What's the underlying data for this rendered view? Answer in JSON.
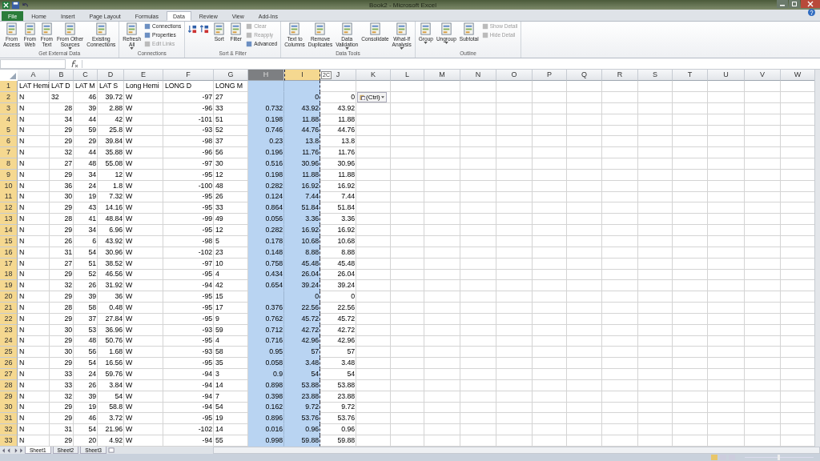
{
  "window": {
    "title": "Book2 - Microsoft Excel"
  },
  "tabs": [
    {
      "label": "File",
      "kind": "file",
      "selected": false
    },
    {
      "label": "Home",
      "kind": "tab",
      "selected": false
    },
    {
      "label": "Insert",
      "kind": "tab",
      "selected": false
    },
    {
      "label": "Page Layout",
      "kind": "tab",
      "selected": false
    },
    {
      "label": "Formulas",
      "kind": "tab",
      "selected": false
    },
    {
      "label": "Data",
      "kind": "tab",
      "selected": true
    },
    {
      "label": "Review",
      "kind": "tab",
      "selected": false
    },
    {
      "label": "View",
      "kind": "tab",
      "selected": false
    },
    {
      "label": "Add-Ins",
      "kind": "tab",
      "selected": false
    }
  ],
  "ribbon": [
    {
      "label": "Get External Data",
      "buttons": [
        {
          "kind": "large",
          "lines": [
            "From",
            "Access"
          ],
          "dropdown": false
        },
        {
          "kind": "large",
          "lines": [
            "From",
            "Web"
          ],
          "dropdown": false
        },
        {
          "kind": "large",
          "lines": [
            "From",
            "Text"
          ],
          "dropdown": false
        },
        {
          "kind": "large",
          "lines": [
            "From Other",
            "Sources"
          ],
          "dropdown": true
        },
        {
          "kind": "large",
          "lines": [
            "Existing",
            "Connections"
          ],
          "dropdown": false
        }
      ]
    },
    {
      "label": "Connections",
      "buttons": [
        {
          "kind": "large",
          "lines": [
            "Refresh",
            "All"
          ],
          "dropdown": true
        },
        {
          "kind": "small",
          "label": "Connections",
          "disabled": false
        },
        {
          "kind": "small",
          "label": "Properties",
          "disabled": false
        },
        {
          "kind": "small",
          "label": "Edit Links",
          "disabled": true
        }
      ]
    },
    {
      "label": "Sort & Filter",
      "buttons": [
        {
          "kind": "sort_asc"
        },
        {
          "kind": "sort_desc"
        },
        {
          "kind": "large",
          "lines": [
            "Sort"
          ],
          "dropdown": false
        },
        {
          "kind": "large",
          "lines": [
            "Filter"
          ],
          "dropdown": false
        },
        {
          "kind": "small",
          "label": "Clear",
          "disabled": true
        },
        {
          "kind": "small",
          "label": "Reapply",
          "disabled": true
        },
        {
          "kind": "small",
          "label": "Advanced",
          "disabled": false
        }
      ]
    },
    {
      "label": "Data Tools",
      "buttons": [
        {
          "kind": "large",
          "lines": [
            "Text to",
            "Columns"
          ],
          "dropdown": false
        },
        {
          "kind": "large",
          "lines": [
            "Remove",
            "Duplicates"
          ],
          "dropdown": false
        },
        {
          "kind": "large",
          "lines": [
            "Data",
            "Validation"
          ],
          "dropdown": true
        },
        {
          "kind": "large",
          "lines": [
            "Consolidate"
          ],
          "dropdown": false
        },
        {
          "kind": "large",
          "lines": [
            "What-If",
            "Analysis"
          ],
          "dropdown": true
        }
      ]
    },
    {
      "label": "Outline",
      "buttons": [
        {
          "kind": "large",
          "lines": [
            "Group"
          ],
          "dropdown": true
        },
        {
          "kind": "large",
          "lines": [
            "Ungroup"
          ],
          "dropdown": true
        },
        {
          "kind": "large",
          "lines": [
            "Subtotal"
          ],
          "dropdown": false
        },
        {
          "kind": "small",
          "label": "Show Detail",
          "disabled": true
        },
        {
          "kind": "small",
          "label": "Hide Detail",
          "disabled": true
        }
      ]
    }
  ],
  "columns": [
    {
      "label": "A",
      "selected": false,
      "marquee": false
    },
    {
      "label": "B",
      "selected": false,
      "marquee": false
    },
    {
      "label": "C",
      "selected": false,
      "marquee": false
    },
    {
      "label": "D",
      "selected": false,
      "marquee": false
    },
    {
      "label": "E",
      "selected": false,
      "marquee": false
    },
    {
      "label": "F",
      "selected": false,
      "marquee": false
    },
    {
      "label": "G",
      "selected": false,
      "marquee": false
    },
    {
      "label": "H",
      "selected": true,
      "marquee": false
    },
    {
      "label": "I",
      "selected": true,
      "marquee": true
    },
    {
      "label": "J",
      "selected": false,
      "marquee": false,
      "badge": "2C"
    },
    {
      "label": "K",
      "selected": false,
      "marquee": false
    },
    {
      "label": "L",
      "selected": false,
      "marquee": false
    },
    {
      "label": "M",
      "selected": false,
      "marquee": false
    },
    {
      "label": "N",
      "selected": false,
      "marquee": false
    },
    {
      "label": "O",
      "selected": false,
      "marquee": false
    },
    {
      "label": "P",
      "selected": false,
      "marquee": false
    },
    {
      "label": "Q",
      "selected": false,
      "marquee": false
    },
    {
      "label": "R",
      "selected": false,
      "marquee": false
    },
    {
      "label": "S",
      "selected": false,
      "marquee": false
    },
    {
      "label": "T",
      "selected": false,
      "marquee": false
    },
    {
      "label": "U",
      "selected": false,
      "marquee": false
    },
    {
      "label": "V",
      "selected": false,
      "marquee": false
    },
    {
      "label": "W",
      "selected": false,
      "marquee": false
    }
  ],
  "rows": [
    {
      "number": "1",
      "cells": [
        {
          "kind": "text",
          "value": "LAT Hemi"
        },
        {
          "kind": "text",
          "value": "LAT D"
        },
        {
          "kind": "text",
          "value": "LAT M"
        },
        {
          "kind": "text",
          "value": "LAT S"
        },
        {
          "kind": "text",
          "value": "Long Hemi"
        },
        {
          "kind": "text",
          "value": "LONG D"
        },
        {
          "kind": "text",
          "value": "LONG M"
        },
        null,
        null,
        null
      ]
    },
    {
      "number": "2",
      "cells": [
        {
          "kind": "text",
          "value": "N"
        },
        {
          "kind": "text",
          "value": "32"
        },
        {
          "kind": "number",
          "value": "46"
        },
        {
          "kind": "number",
          "value": "39.72"
        },
        {
          "kind": "text",
          "value": "W"
        },
        {
          "kind": "number",
          "value": "-97"
        },
        {
          "kind": "text",
          "value": "27"
        },
        null,
        {
          "kind": "number",
          "value": "0"
        },
        {
          "kind": "number",
          "value": "0"
        },
        {
          "kind": "paste",
          "value": "(Ctrl)"
        }
      ]
    },
    {
      "number": "3",
      "cells": [
        {
          "kind": "text",
          "value": "N"
        },
        {
          "kind": "number",
          "value": "28"
        },
        {
          "kind": "number",
          "value": "39"
        },
        {
          "kind": "number",
          "value": "2.88"
        },
        {
          "kind": "text",
          "value": "W"
        },
        {
          "kind": "number",
          "value": "-96"
        },
        {
          "kind": "text",
          "value": "33"
        },
        {
          "kind": "number",
          "value": "0.732"
        },
        {
          "kind": "number",
          "value": "43.92"
        },
        {
          "kind": "number",
          "value": "43.92"
        }
      ]
    },
    {
      "number": "4",
      "cells": [
        {
          "kind": "text",
          "value": "N"
        },
        {
          "kind": "number",
          "value": "34"
        },
        {
          "kind": "number",
          "value": "44"
        },
        {
          "kind": "number",
          "value": "42"
        },
        {
          "kind": "text",
          "value": "W"
        },
        {
          "kind": "number",
          "value": "-101"
        },
        {
          "kind": "text",
          "value": "51"
        },
        {
          "kind": "number",
          "value": "0.198"
        },
        {
          "kind": "number",
          "value": "11.88"
        },
        {
          "kind": "number",
          "value": "11.88"
        }
      ]
    },
    {
      "number": "5",
      "cells": [
        {
          "kind": "text",
          "value": "N"
        },
        {
          "kind": "number",
          "value": "29"
        },
        {
          "kind": "number",
          "value": "59"
        },
        {
          "kind": "number",
          "value": "25.8"
        },
        {
          "kind": "text",
          "value": "W"
        },
        {
          "kind": "number",
          "value": "-93"
        },
        {
          "kind": "text",
          "value": "52"
        },
        {
          "kind": "number",
          "value": "0.746"
        },
        {
          "kind": "number",
          "value": "44.76"
        },
        {
          "kind": "number",
          "value": "44.76"
        }
      ]
    },
    {
      "number": "6",
      "cells": [
        {
          "kind": "text",
          "value": "N"
        },
        {
          "kind": "number",
          "value": "29"
        },
        {
          "kind": "number",
          "value": "29"
        },
        {
          "kind": "number",
          "value": "39.84"
        },
        {
          "kind": "text",
          "value": "W"
        },
        {
          "kind": "number",
          "value": "-98"
        },
        {
          "kind": "text",
          "value": "37"
        },
        {
          "kind": "number",
          "value": "0.23"
        },
        {
          "kind": "number",
          "value": "13.8"
        },
        {
          "kind": "number",
          "value": "13.8"
        }
      ]
    },
    {
      "number": "7",
      "cells": [
        {
          "kind": "text",
          "value": "N"
        },
        {
          "kind": "number",
          "value": "32"
        },
        {
          "kind": "number",
          "value": "44"
        },
        {
          "kind": "number",
          "value": "35.88"
        },
        {
          "kind": "text",
          "value": "W"
        },
        {
          "kind": "number",
          "value": "-96"
        },
        {
          "kind": "text",
          "value": "56"
        },
        {
          "kind": "number",
          "value": "0.196"
        },
        {
          "kind": "number",
          "value": "11.76"
        },
        {
          "kind": "number",
          "value": "11.76"
        }
      ]
    },
    {
      "number": "8",
      "cells": [
        {
          "kind": "text",
          "value": "N"
        },
        {
          "kind": "number",
          "value": "27"
        },
        {
          "kind": "number",
          "value": "48"
        },
        {
          "kind": "number",
          "value": "55.08"
        },
        {
          "kind": "text",
          "value": "W"
        },
        {
          "kind": "number",
          "value": "-97"
        },
        {
          "kind": "text",
          "value": "30"
        },
        {
          "kind": "number",
          "value": "0.516"
        },
        {
          "kind": "number",
          "value": "30.96"
        },
        {
          "kind": "number",
          "value": "30.96"
        }
      ]
    },
    {
      "number": "9",
      "cells": [
        {
          "kind": "text",
          "value": "N"
        },
        {
          "kind": "number",
          "value": "29"
        },
        {
          "kind": "number",
          "value": "34"
        },
        {
          "kind": "number",
          "value": "12"
        },
        {
          "kind": "text",
          "value": "W"
        },
        {
          "kind": "number",
          "value": "-95"
        },
        {
          "kind": "text",
          "value": "12"
        },
        {
          "kind": "number",
          "value": "0.198"
        },
        {
          "kind": "number",
          "value": "11.88"
        },
        {
          "kind": "number",
          "value": "11.88"
        }
      ]
    },
    {
      "number": "10",
      "cells": [
        {
          "kind": "text",
          "value": "N"
        },
        {
          "kind": "number",
          "value": "36"
        },
        {
          "kind": "number",
          "value": "24"
        },
        {
          "kind": "number",
          "value": "1.8"
        },
        {
          "kind": "text",
          "value": "W"
        },
        {
          "kind": "number",
          "value": "-100"
        },
        {
          "kind": "text",
          "value": "48"
        },
        {
          "kind": "number",
          "value": "0.282"
        },
        {
          "kind": "number",
          "value": "16.92"
        },
        {
          "kind": "number",
          "value": "16.92"
        }
      ]
    },
    {
      "number": "11",
      "cells": [
        {
          "kind": "text",
          "value": "N"
        },
        {
          "kind": "number",
          "value": "30"
        },
        {
          "kind": "number",
          "value": "19"
        },
        {
          "kind": "number",
          "value": "7.32"
        },
        {
          "kind": "text",
          "value": "W"
        },
        {
          "kind": "number",
          "value": "-95"
        },
        {
          "kind": "text",
          "value": "26"
        },
        {
          "kind": "number",
          "value": "0.124"
        },
        {
          "kind": "number",
          "value": "7.44"
        },
        {
          "kind": "number",
          "value": "7.44"
        }
      ]
    },
    {
      "number": "12",
      "cells": [
        {
          "kind": "text",
          "value": "N"
        },
        {
          "kind": "number",
          "value": "29"
        },
        {
          "kind": "number",
          "value": "43"
        },
        {
          "kind": "number",
          "value": "14.16"
        },
        {
          "kind": "text",
          "value": "W"
        },
        {
          "kind": "number",
          "value": "-95"
        },
        {
          "kind": "text",
          "value": "33"
        },
        {
          "kind": "number",
          "value": "0.864"
        },
        {
          "kind": "number",
          "value": "51.84"
        },
        {
          "kind": "number",
          "value": "51.84"
        }
      ]
    },
    {
      "number": "13",
      "cells": [
        {
          "kind": "text",
          "value": "N"
        },
        {
          "kind": "number",
          "value": "28"
        },
        {
          "kind": "number",
          "value": "41"
        },
        {
          "kind": "number",
          "value": "48.84"
        },
        {
          "kind": "text",
          "value": "W"
        },
        {
          "kind": "number",
          "value": "-99"
        },
        {
          "kind": "text",
          "value": "49"
        },
        {
          "kind": "number",
          "value": "0.056"
        },
        {
          "kind": "number",
          "value": "3.36"
        },
        {
          "kind": "number",
          "value": "3.36"
        }
      ]
    },
    {
      "number": "14",
      "cells": [
        {
          "kind": "text",
          "value": "N"
        },
        {
          "kind": "number",
          "value": "29"
        },
        {
          "kind": "number",
          "value": "34"
        },
        {
          "kind": "number",
          "value": "6.96"
        },
        {
          "kind": "text",
          "value": "W"
        },
        {
          "kind": "number",
          "value": "-95"
        },
        {
          "kind": "text",
          "value": "12"
        },
        {
          "kind": "number",
          "value": "0.282"
        },
        {
          "kind": "number",
          "value": "16.92"
        },
        {
          "kind": "number",
          "value": "16.92"
        }
      ]
    },
    {
      "number": "15",
      "cells": [
        {
          "kind": "text",
          "value": "N"
        },
        {
          "kind": "number",
          "value": "26"
        },
        {
          "kind": "number",
          "value": "6"
        },
        {
          "kind": "number",
          "value": "43.92"
        },
        {
          "kind": "text",
          "value": "W"
        },
        {
          "kind": "number",
          "value": "-98"
        },
        {
          "kind": "text",
          "value": "5"
        },
        {
          "kind": "number",
          "value": "0.178"
        },
        {
          "kind": "number",
          "value": "10.68"
        },
        {
          "kind": "number",
          "value": "10.68"
        }
      ]
    },
    {
      "number": "16",
      "cells": [
        {
          "kind": "text",
          "value": "N"
        },
        {
          "kind": "number",
          "value": "31"
        },
        {
          "kind": "number",
          "value": "54"
        },
        {
          "kind": "number",
          "value": "30.96"
        },
        {
          "kind": "text",
          "value": "W"
        },
        {
          "kind": "number",
          "value": "-102"
        },
        {
          "kind": "text",
          "value": "23"
        },
        {
          "kind": "number",
          "value": "0.148"
        },
        {
          "kind": "number",
          "value": "8.88"
        },
        {
          "kind": "number",
          "value": "8.88"
        }
      ]
    },
    {
      "number": "17",
      "cells": [
        {
          "kind": "text",
          "value": "N"
        },
        {
          "kind": "number",
          "value": "27"
        },
        {
          "kind": "number",
          "value": "51"
        },
        {
          "kind": "number",
          "value": "38.52"
        },
        {
          "kind": "text",
          "value": "W"
        },
        {
          "kind": "number",
          "value": "-97"
        },
        {
          "kind": "text",
          "value": "10"
        },
        {
          "kind": "number",
          "value": "0.758"
        },
        {
          "kind": "number",
          "value": "45.48"
        },
        {
          "kind": "number",
          "value": "45.48"
        }
      ]
    },
    {
      "number": "18",
      "cells": [
        {
          "kind": "text",
          "value": "N"
        },
        {
          "kind": "number",
          "value": "29"
        },
        {
          "kind": "number",
          "value": "52"
        },
        {
          "kind": "number",
          "value": "46.56"
        },
        {
          "kind": "text",
          "value": "W"
        },
        {
          "kind": "number",
          "value": "-95"
        },
        {
          "kind": "text",
          "value": "4"
        },
        {
          "kind": "number",
          "value": "0.434"
        },
        {
          "kind": "number",
          "value": "26.04"
        },
        {
          "kind": "number",
          "value": "26.04"
        }
      ]
    },
    {
      "number": "19",
      "cells": [
        {
          "kind": "text",
          "value": "N"
        },
        {
          "kind": "number",
          "value": "32"
        },
        {
          "kind": "number",
          "value": "26"
        },
        {
          "kind": "number",
          "value": "31.92"
        },
        {
          "kind": "text",
          "value": "W"
        },
        {
          "kind": "number",
          "value": "-94"
        },
        {
          "kind": "text",
          "value": "42"
        },
        {
          "kind": "number",
          "value": "0.654"
        },
        {
          "kind": "number",
          "value": "39.24"
        },
        {
          "kind": "number",
          "value": "39.24"
        }
      ]
    },
    {
      "number": "20",
      "cells": [
        {
          "kind": "text",
          "value": "N"
        },
        {
          "kind": "number",
          "value": "29"
        },
        {
          "kind": "number",
          "value": "39"
        },
        {
          "kind": "number",
          "value": "36"
        },
        {
          "kind": "text",
          "value": "W"
        },
        {
          "kind": "number",
          "value": "-95"
        },
        {
          "kind": "text",
          "value": "15"
        },
        null,
        {
          "kind": "number",
          "value": "0"
        },
        {
          "kind": "number",
          "value": "0"
        }
      ]
    },
    {
      "number": "21",
      "cells": [
        {
          "kind": "text",
          "value": "N"
        },
        {
          "kind": "number",
          "value": "28"
        },
        {
          "kind": "number",
          "value": "58"
        },
        {
          "kind": "number",
          "value": "0.48"
        },
        {
          "kind": "text",
          "value": "W"
        },
        {
          "kind": "number",
          "value": "-95"
        },
        {
          "kind": "text",
          "value": "17"
        },
        {
          "kind": "number",
          "value": "0.376"
        },
        {
          "kind": "number",
          "value": "22.56"
        },
        {
          "kind": "number",
          "value": "22.56"
        }
      ]
    },
    {
      "number": "22",
      "cells": [
        {
          "kind": "text",
          "value": "N"
        },
        {
          "kind": "number",
          "value": "29"
        },
        {
          "kind": "number",
          "value": "37"
        },
        {
          "kind": "number",
          "value": "27.84"
        },
        {
          "kind": "text",
          "value": "W"
        },
        {
          "kind": "number",
          "value": "-95"
        },
        {
          "kind": "text",
          "value": "9"
        },
        {
          "kind": "number",
          "value": "0.762"
        },
        {
          "kind": "number",
          "value": "45.72"
        },
        {
          "kind": "number",
          "value": "45.72"
        }
      ]
    },
    {
      "number": "23",
      "cells": [
        {
          "kind": "text",
          "value": "N"
        },
        {
          "kind": "number",
          "value": "30"
        },
        {
          "kind": "number",
          "value": "53"
        },
        {
          "kind": "number",
          "value": "36.96"
        },
        {
          "kind": "text",
          "value": "W"
        },
        {
          "kind": "number",
          "value": "-93"
        },
        {
          "kind": "text",
          "value": "59"
        },
        {
          "kind": "number",
          "value": "0.712"
        },
        {
          "kind": "number",
          "value": "42.72"
        },
        {
          "kind": "number",
          "value": "42.72"
        }
      ]
    },
    {
      "number": "24",
      "cells": [
        {
          "kind": "text",
          "value": "N"
        },
        {
          "kind": "number",
          "value": "29"
        },
        {
          "kind": "number",
          "value": "48"
        },
        {
          "kind": "number",
          "value": "50.76"
        },
        {
          "kind": "text",
          "value": "W"
        },
        {
          "kind": "number",
          "value": "-95"
        },
        {
          "kind": "text",
          "value": "4"
        },
        {
          "kind": "number",
          "value": "0.716"
        },
        {
          "kind": "number",
          "value": "42.96"
        },
        {
          "kind": "number",
          "value": "42.96"
        }
      ]
    },
    {
      "number": "25",
      "cells": [
        {
          "kind": "text",
          "value": "N"
        },
        {
          "kind": "number",
          "value": "30"
        },
        {
          "kind": "number",
          "value": "56"
        },
        {
          "kind": "number",
          "value": "1.68"
        },
        {
          "kind": "text",
          "value": "W"
        },
        {
          "kind": "number",
          "value": "-93"
        },
        {
          "kind": "text",
          "value": "58"
        },
        {
          "kind": "number",
          "value": "0.95"
        },
        {
          "kind": "number",
          "value": "57"
        },
        {
          "kind": "number",
          "value": "57"
        }
      ]
    },
    {
      "number": "26",
      "cells": [
        {
          "kind": "text",
          "value": "N"
        },
        {
          "kind": "number",
          "value": "29"
        },
        {
          "kind": "number",
          "value": "54"
        },
        {
          "kind": "number",
          "value": "16.56"
        },
        {
          "kind": "text",
          "value": "W"
        },
        {
          "kind": "number",
          "value": "-95"
        },
        {
          "kind": "text",
          "value": "35"
        },
        {
          "kind": "number",
          "value": "0.058"
        },
        {
          "kind": "number",
          "value": "3.48"
        },
        {
          "kind": "number",
          "value": "3.48"
        }
      ]
    },
    {
      "number": "27",
      "cells": [
        {
          "kind": "text",
          "value": "N"
        },
        {
          "kind": "number",
          "value": "33"
        },
        {
          "kind": "number",
          "value": "24"
        },
        {
          "kind": "number",
          "value": "59.76"
        },
        {
          "kind": "text",
          "value": "W"
        },
        {
          "kind": "number",
          "value": "-94"
        },
        {
          "kind": "text",
          "value": "3"
        },
        {
          "kind": "number",
          "value": "0.9"
        },
        {
          "kind": "number",
          "value": "54"
        },
        {
          "kind": "number",
          "value": "54"
        }
      ]
    },
    {
      "number": "28",
      "cells": [
        {
          "kind": "text",
          "value": "N"
        },
        {
          "kind": "number",
          "value": "33"
        },
        {
          "kind": "number",
          "value": "26"
        },
        {
          "kind": "number",
          "value": "3.84"
        },
        {
          "kind": "text",
          "value": "W"
        },
        {
          "kind": "number",
          "value": "-94"
        },
        {
          "kind": "text",
          "value": "14"
        },
        {
          "kind": "number",
          "value": "0.898"
        },
        {
          "kind": "number",
          "value": "53.88"
        },
        {
          "kind": "number",
          "value": "53.88"
        }
      ]
    },
    {
      "number": "29",
      "cells": [
        {
          "kind": "text",
          "value": "N"
        },
        {
          "kind": "number",
          "value": "32"
        },
        {
          "kind": "number",
          "value": "39"
        },
        {
          "kind": "number",
          "value": "54"
        },
        {
          "kind": "text",
          "value": "W"
        },
        {
          "kind": "number",
          "value": "-94"
        },
        {
          "kind": "text",
          "value": "7"
        },
        {
          "kind": "number",
          "value": "0.398"
        },
        {
          "kind": "number",
          "value": "23.88"
        },
        {
          "kind": "number",
          "value": "23.88"
        }
      ]
    },
    {
      "number": "30",
      "cells": [
        {
          "kind": "text",
          "value": "N"
        },
        {
          "kind": "number",
          "value": "29"
        },
        {
          "kind": "number",
          "value": "19"
        },
        {
          "kind": "number",
          "value": "58.8"
        },
        {
          "kind": "text",
          "value": "W"
        },
        {
          "kind": "number",
          "value": "-94"
        },
        {
          "kind": "text",
          "value": "54"
        },
        {
          "kind": "number",
          "value": "0.162"
        },
        {
          "kind": "number",
          "value": "9.72"
        },
        {
          "kind": "number",
          "value": "9.72"
        }
      ]
    },
    {
      "number": "31",
      "cells": [
        {
          "kind": "text",
          "value": "N"
        },
        {
          "kind": "number",
          "value": "29"
        },
        {
          "kind": "number",
          "value": "46"
        },
        {
          "kind": "number",
          "value": "3.72"
        },
        {
          "kind": "text",
          "value": "W"
        },
        {
          "kind": "number",
          "value": "-95"
        },
        {
          "kind": "text",
          "value": "19"
        },
        {
          "kind": "number",
          "value": "0.896"
        },
        {
          "kind": "number",
          "value": "53.76"
        },
        {
          "kind": "number",
          "value": "53.76"
        }
      ]
    },
    {
      "number": "32",
      "cells": [
        {
          "kind": "text",
          "value": "N"
        },
        {
          "kind": "number",
          "value": "31"
        },
        {
          "kind": "number",
          "value": "54"
        },
        {
          "kind": "number",
          "value": "21.96"
        },
        {
          "kind": "text",
          "value": "W"
        },
        {
          "kind": "number",
          "value": "-102"
        },
        {
          "kind": "text",
          "value": "14"
        },
        {
          "kind": "number",
          "value": "0.016"
        },
        {
          "kind": "number",
          "value": "0.96"
        },
        {
          "kind": "number",
          "value": "0.96"
        }
      ]
    },
    {
      "number": "33",
      "cells": [
        {
          "kind": "text",
          "value": "N"
        },
        {
          "kind": "number",
          "value": "29"
        },
        {
          "kind": "number",
          "value": "20"
        },
        {
          "kind": "number",
          "value": "4.92"
        },
        {
          "kind": "text",
          "value": "W"
        },
        {
          "kind": "number",
          "value": "-94"
        },
        {
          "kind": "text",
          "value": "55"
        },
        {
          "kind": "number",
          "value": "0.998"
        },
        {
          "kind": "number",
          "value": "59.88"
        },
        {
          "kind": "number",
          "value": "59.88"
        }
      ]
    }
  ],
  "sheets": [
    {
      "label": "Sheet1",
      "selected": true
    },
    {
      "label": "Sheet2",
      "selected": false
    },
    {
      "label": "Sheet3",
      "selected": false
    }
  ]
}
